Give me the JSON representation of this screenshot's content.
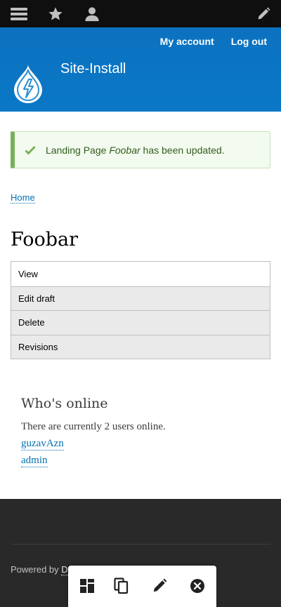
{
  "toolbar": {
    "icons": [
      "menu-icon",
      "star-icon",
      "user-icon",
      "pencil-icon"
    ]
  },
  "header": {
    "site_name": "Site-Install",
    "links": {
      "my_account": "My account",
      "log_out": "Log out"
    },
    "brand_color": "#0a75c2"
  },
  "message": {
    "prefix": "Landing Page ",
    "emphasis": "Foobar",
    "suffix": " has been updated.",
    "status_color": "#77b259"
  },
  "breadcrumb": {
    "home": "Home"
  },
  "page": {
    "title": "Foobar"
  },
  "tabs": [
    {
      "label": "View"
    },
    {
      "label": "Edit draft"
    },
    {
      "label": "Delete"
    },
    {
      "label": "Revisions"
    }
  ],
  "whos_online": {
    "title": "Who's online",
    "text": "There are currently 2 users online.",
    "users": [
      "guzavAzn",
      "admin"
    ]
  },
  "footer": {
    "powered_prefix": "Powered by ",
    "powered_link": "Dr"
  },
  "tray": {
    "icons": [
      "layout-icon",
      "copy-icon",
      "pencil-icon",
      "close-circle-icon"
    ]
  }
}
